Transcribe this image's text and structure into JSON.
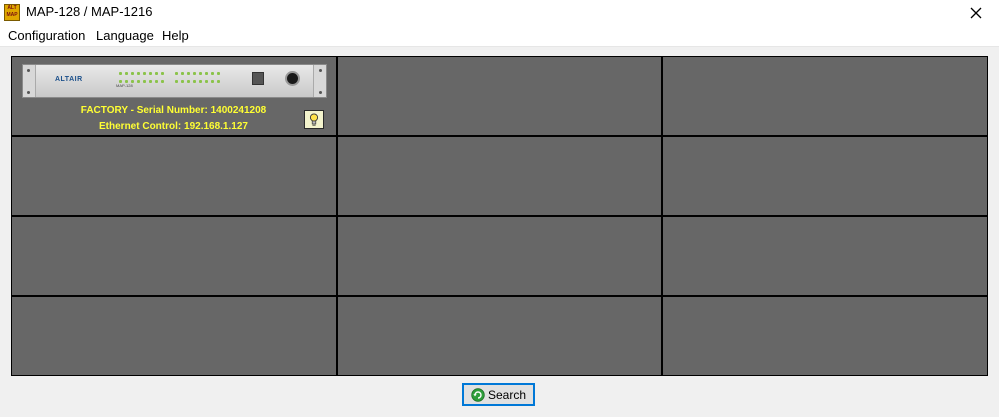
{
  "window": {
    "app_icon_text": "ALT MAP",
    "title": "MAP-128 / MAP-1216",
    "close_icon": "close-icon"
  },
  "menu": {
    "items": [
      "Configuration",
      "Language",
      "Help"
    ]
  },
  "devices": [
    {
      "brand": "ALTAIR",
      "model": "MAP-128",
      "line1": "FACTORY  - Serial Number: 1400241208",
      "line2": "Ethernet Control: 192.168.1.127",
      "identify_icon": "lightbulb-icon"
    }
  ],
  "grid": {
    "rows": 4,
    "columns": 3
  },
  "actions": {
    "search_label": "Search",
    "search_icon": "refresh-icon"
  },
  "colors": {
    "panel": "#676767",
    "grid_lines": "#000000",
    "device_text": "#ffff33",
    "focus_border": "#0078d7"
  }
}
